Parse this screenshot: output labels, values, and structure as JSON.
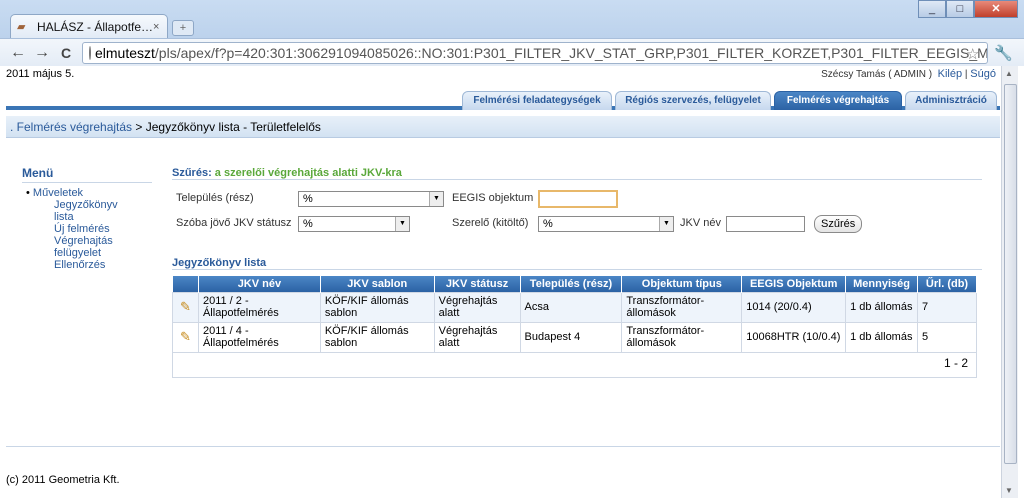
{
  "browser": {
    "tab_title": "HALÁSZ - Állapotfe…",
    "tab_close": "×",
    "new_tab": "+",
    "url_host": "elmuteszt",
    "url_path": "/pls/apex/f?p=420:301:306291094085026::NO:301:P301_FILTER_JKV_STAT_GRP,P301_FILTER_KORZET,P301_FILTER_EEGIS_ME",
    "back": "←",
    "forward": "→",
    "reload": "C",
    "star": "☆",
    "wrench": "🔧",
    "minimize": "_",
    "maximize": "□",
    "close": "✕"
  },
  "header": {
    "date": "2011 május 5.",
    "user": "Szécsy Tamás ( ADMIN )",
    "logout": "Kilép",
    "separator": "|",
    "help": "Súgó"
  },
  "tabs": [
    {
      "label": "Felmérési feladategységek"
    },
    {
      "label": "Régiós szervezés, felügyelet"
    },
    {
      "label": "Felmérés végrehajtás"
    },
    {
      "label": "Adminisztráció"
    }
  ],
  "breadcrumb": {
    "link": ". Felmérés végrehajtás",
    "rest": " > Jegyzőkönyv lista - Területfelelős"
  },
  "menu": {
    "title": "Menü",
    "top": "Műveletek",
    "items": [
      "Jegyzőkönyv lista",
      "Új felmérés",
      "Végrehajtás felügyelet",
      "Ellenőrzés"
    ]
  },
  "filter": {
    "title": "Szűrés:",
    "subtitle": " a szerelői végrehajtás alatti JKV-kra",
    "telepules_label": "Település (rész)",
    "telepules_value": "%",
    "eegis_label": "EEGIS objektum",
    "eegis_value": "",
    "statusz_label": "Szóba jövő JKV státusz",
    "statusz_value": "%",
    "szerelo_label": "Szerelő (kitöltő)",
    "szerelo_value": "%",
    "jkv_nev_label": "JKV név",
    "jkv_nev_value": "",
    "button": "Szűrés"
  },
  "list": {
    "title": "Jegyzőkönyv lista",
    "columns": [
      "JKV név",
      "JKV sablon",
      "JKV státusz",
      "Település (rész)",
      "Objektum típus",
      "EEGIS Objektum",
      "Mennyiség",
      "Űrl. (db)"
    ],
    "rows": [
      {
        "nev": "2011 / 2 - Állapotfelmérés",
        "sablon": "KÖF/KIF állomás sablon",
        "statusz": "Végrehajtás alatt",
        "telepules": "Acsa",
        "tipus": "Transzformátor-állomások",
        "eegis": "1014 (20/0.4)",
        "mennyiseg": "1 db állomás",
        "url": "7"
      },
      {
        "nev": "2011 / 4 - Állapotfelmérés",
        "sablon": "KÖF/KIF állomás sablon",
        "statusz": "Végrehajtás alatt",
        "telepules": "Budapest 4",
        "tipus": "Transzformátor-állomások",
        "eegis": "10068HTR (10/0.4)",
        "mennyiseg": "1 db állomás",
        "url": "5"
      }
    ],
    "pager": "1 - 2",
    "edit_icon": "✎"
  },
  "footer": {
    "copyright": "(c) 2011 Geometria Kft."
  }
}
